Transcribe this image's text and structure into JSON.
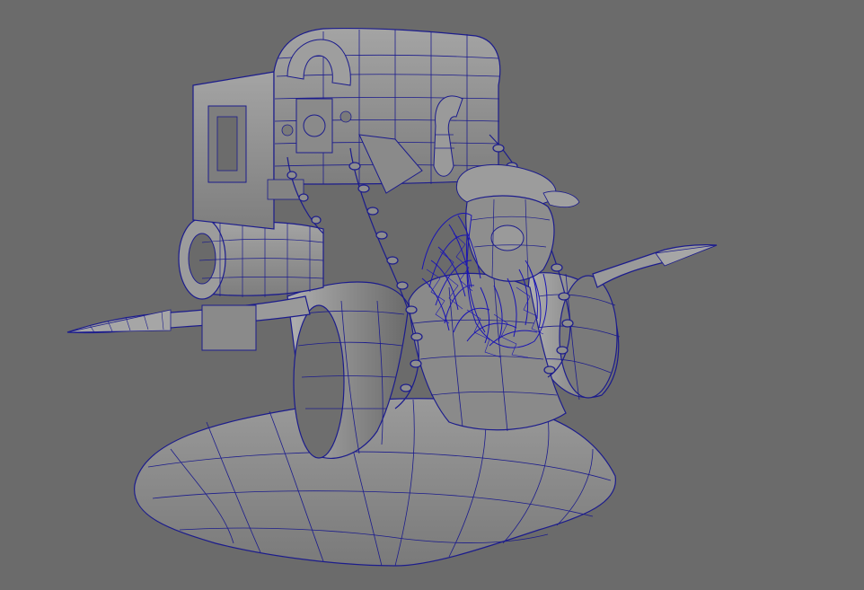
{
  "viewport": {
    "background_color": "#6b6b6b",
    "mesh_fill_color": "#8e8e8e",
    "mesh_shadow_color": "#5e5e5e",
    "wireframe_color": "#1c1c8c",
    "wireframe_dense_color": "#1a14b4"
  },
  "scene_object": {
    "icon": "wireframe-mesh-icon"
  }
}
